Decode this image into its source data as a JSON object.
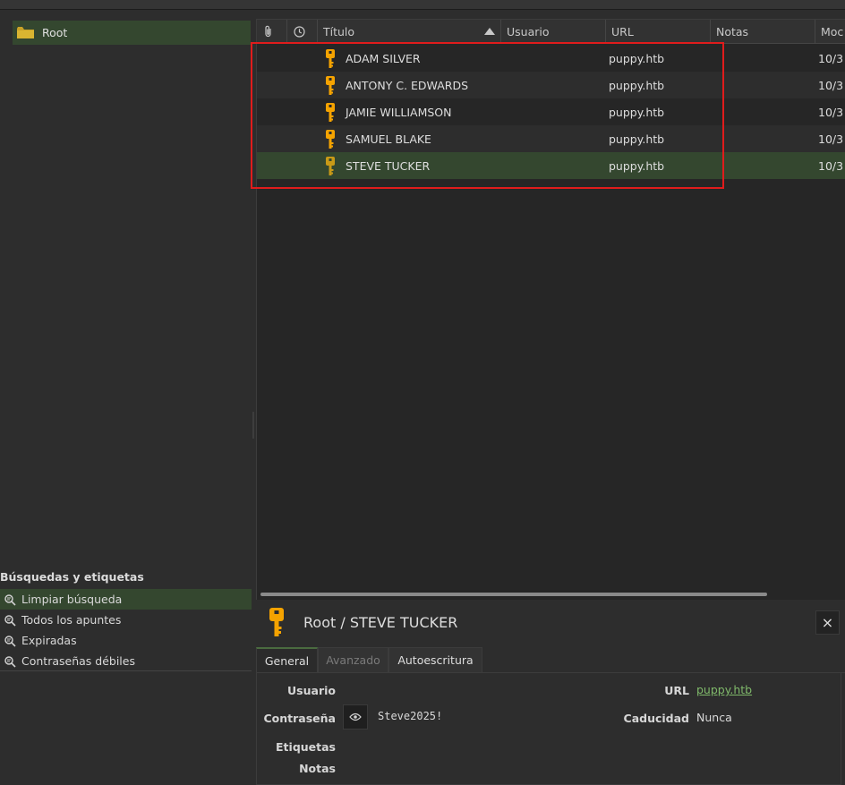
{
  "sidebar": {
    "root_label": "Root",
    "searches_title": "Búsquedas y etiquetas",
    "searches": [
      {
        "label": "Limpiar búsqueda"
      },
      {
        "label": "Todos los apuntes"
      },
      {
        "label": "Expiradas"
      },
      {
        "label": "Contraseñas débiles"
      }
    ]
  },
  "table": {
    "columns": {
      "title": "Título",
      "user": "Usuario",
      "url": "URL",
      "notes": "Notas",
      "modified": "Moc"
    },
    "sort": "ascending",
    "rows": [
      {
        "title": "ADAM SILVER",
        "user": "",
        "url": "puppy.htb",
        "notes": "",
        "modified": "10/3"
      },
      {
        "title": "ANTONY C. EDWARDS",
        "user": "",
        "url": "puppy.htb",
        "notes": "",
        "modified": "10/3"
      },
      {
        "title": "JAMIE WILLIAMSON",
        "user": "",
        "url": "puppy.htb",
        "notes": "",
        "modified": "10/3"
      },
      {
        "title": "SAMUEL BLAKE",
        "user": "",
        "url": "puppy.htb",
        "notes": "",
        "modified": "10/3"
      },
      {
        "title": "STEVE TUCKER",
        "user": "",
        "url": "puppy.htb",
        "notes": "",
        "modified": "10/3"
      }
    ],
    "selected_index": 4
  },
  "details": {
    "title": "Root / STEVE TUCKER",
    "close_label": "×",
    "tabs": [
      {
        "label": "General"
      },
      {
        "label": "Avanzado"
      },
      {
        "label": "Autoescritura"
      }
    ],
    "fields": {
      "user_label": "Usuario",
      "user_value": "",
      "password_label": "Contraseña",
      "password_value": "Steve2025!",
      "tags_label": "Etiquetas",
      "notes_label": "Notas",
      "url_label": "URL",
      "url_value": "puppy.htb",
      "expiry_label": "Caducidad",
      "expiry_value": "Nunca"
    }
  },
  "colors": {
    "selection": "#34472f",
    "key_icon": "#f5a300",
    "highlight_box": "#e01c1c",
    "link": "#7fb86a"
  }
}
